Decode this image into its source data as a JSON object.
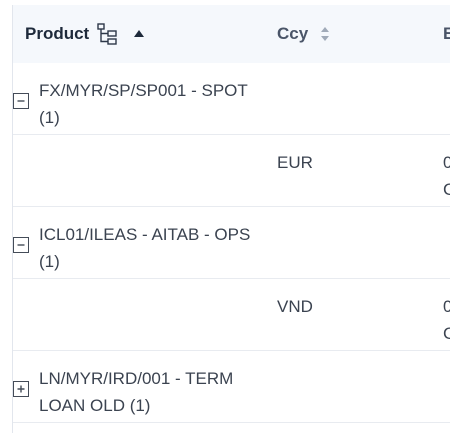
{
  "columns": {
    "product": "Product",
    "ccy": "Ccy",
    "third_partial": "E"
  },
  "rows": [
    {
      "group": "FX/MYR/SP/SP001 - SPOT (1)",
      "expanded": true
    },
    {
      "ccy": "EUR",
      "third_line1": "0",
      "third_line2": "C"
    },
    {
      "group": "ICL01/ILEAS - AITAB - OPS (1)",
      "expanded": true
    },
    {
      "ccy": "VND",
      "third_line1": "0",
      "third_line2": "C"
    },
    {
      "group": "LN/MYR/IRD/001 - TERM LOAN OLD (1)",
      "expanded": false
    }
  ]
}
